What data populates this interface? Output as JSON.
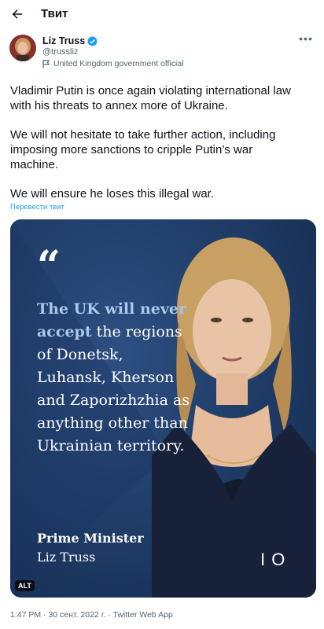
{
  "header": {
    "title": "Твит"
  },
  "author": {
    "name": "Liz Truss",
    "handle": "@trussliz",
    "label": "United Kingdom government official"
  },
  "tweet": {
    "paragraphs": [
      "Vladimir Putin is once again violating international law\nwith his threats to annex more of Ukraine.",
      "We will not hesitate to take further action, including\nimposing more sanctions to cripple Putin’s war\nmachine.",
      "We will ensure he loses this illegal war."
    ],
    "translate_link": "Перевести твит"
  },
  "media": {
    "quote_mark": "“",
    "statement_highlight": "The UK will never accept",
    "statement_rest": "the regions of Donetsk, Luhansk, Kherson and Zaporizhzhia as anything other than Ukrainian territory.",
    "attribution_title": "Prime Minister",
    "attribution_name": "Liz Truss",
    "logo_text": "I O",
    "alt_badge": "ALT"
  },
  "meta": {
    "time": "1:47 PM",
    "date": "30 сент. 2022 г.",
    "source": "Twitter Web App",
    "separator": " · "
  },
  "colors": {
    "accent": "#1d9bf0",
    "media_background": "#1f3860",
    "highlight_text": "#a9c8ea"
  },
  "icons": {
    "back": "arrow-left-icon",
    "verified": "verified-badge-icon",
    "label": "flag-icon",
    "more": "more-dots-icon"
  }
}
